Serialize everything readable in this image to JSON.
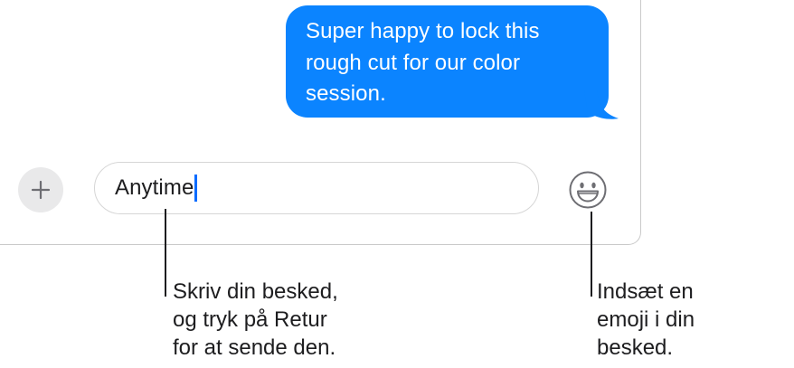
{
  "conversation": {
    "sent_message": "Super happy to lock this rough cut for our color session.",
    "bubble_color": "#0b84ff"
  },
  "composer": {
    "add_icon": "plus-icon",
    "input_value": "Anytime",
    "emoji_icon": "smiley-face-icon",
    "caret_color": "#0a6cff"
  },
  "callouts": {
    "input_hint": "Skriv din besked,\nog tryk på Retur\nfor at sende den.",
    "emoji_hint": "Indsæt en\nemoji i din\nbesked."
  }
}
